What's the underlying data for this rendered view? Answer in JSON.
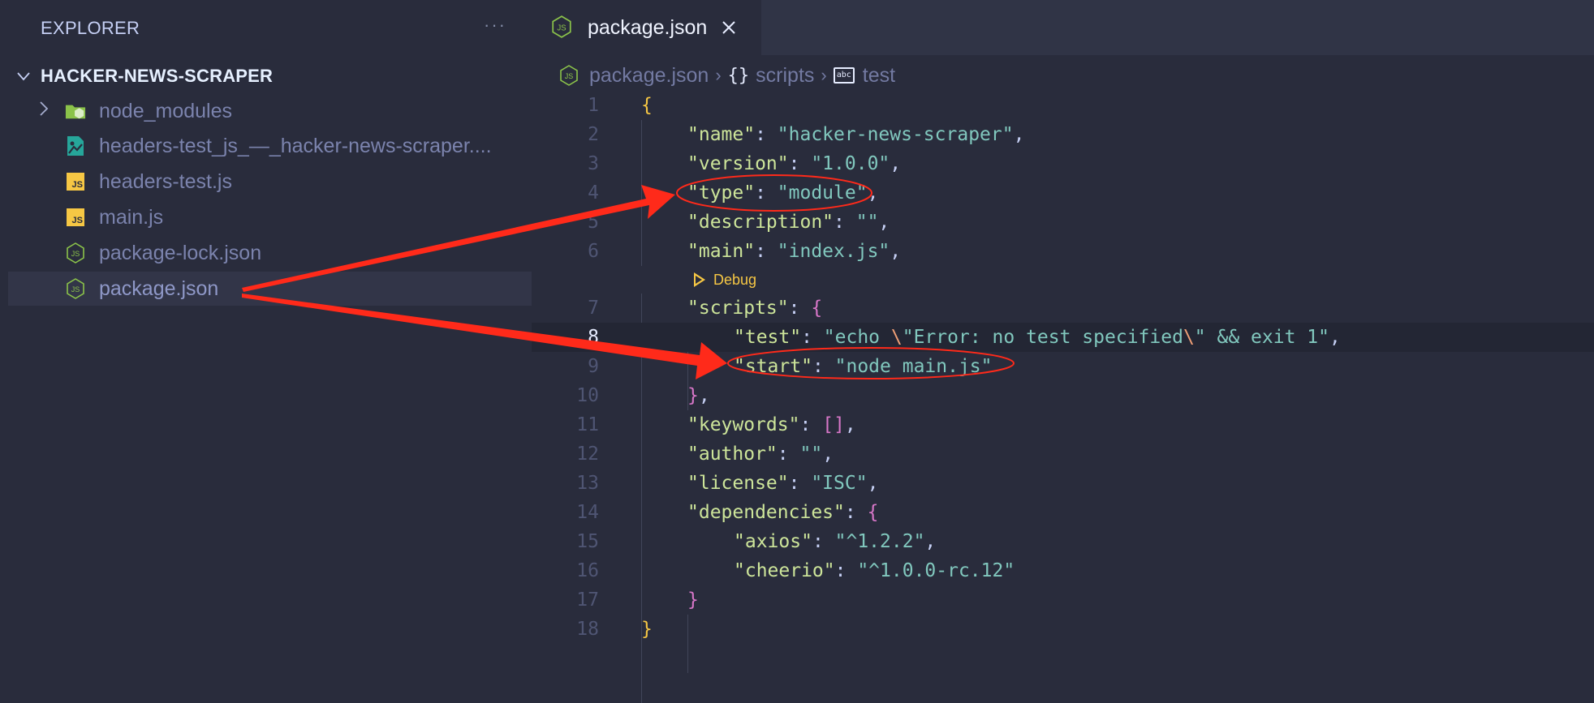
{
  "sidebar": {
    "title": "EXPLORER",
    "more_icon": "ellipsis-icon",
    "project_name": "HACKER-NEWS-SCRAPER",
    "items": [
      {
        "label": "node_modules",
        "icon": "node-folder-icon",
        "type": "folder",
        "collapsed": true
      },
      {
        "label": "headers-test_js_—_hacker-news-scraper....",
        "icon": "image-file-icon",
        "type": "file"
      },
      {
        "label": "headers-test.js",
        "icon": "javascript-file-icon",
        "type": "file"
      },
      {
        "label": "main.js",
        "icon": "javascript-file-icon",
        "type": "file"
      },
      {
        "label": "package-lock.json",
        "icon": "nodejs-icon",
        "type": "file"
      },
      {
        "label": "package.json",
        "icon": "nodejs-icon",
        "type": "file",
        "selected": true
      }
    ]
  },
  "tabs": [
    {
      "label": "package.json",
      "icon": "nodejs-icon",
      "active": true,
      "close_icon": "close-icon"
    }
  ],
  "breadcrumb": [
    {
      "label": "package.json",
      "icon": "nodejs-icon"
    },
    {
      "label": "scripts",
      "icon": "braces-icon"
    },
    {
      "label": "test",
      "icon": "string-abc-icon"
    }
  ],
  "codelens": {
    "label": "Debug",
    "icon": "play-icon"
  },
  "editor": {
    "current_line": 8,
    "lines": [
      {
        "n": "1"
      },
      {
        "n": "2"
      },
      {
        "n": "3"
      },
      {
        "n": "4"
      },
      {
        "n": "5"
      },
      {
        "n": "6"
      },
      {
        "n": "7"
      },
      {
        "n": "8"
      },
      {
        "n": "9"
      },
      {
        "n": "10"
      },
      {
        "n": "11"
      },
      {
        "n": "12"
      },
      {
        "n": "13"
      },
      {
        "n": "14"
      },
      {
        "n": "15"
      },
      {
        "n": "16"
      },
      {
        "n": "17"
      },
      {
        "n": "18"
      }
    ],
    "tokens": {
      "l1_open": "{",
      "l2_key": "\"name\"",
      "l2_val": "\"hacker-news-scraper\"",
      "l3_key": "\"version\"",
      "l3_val": "\"1.0.0\"",
      "l4_key": "\"type\"",
      "l4_val": "\"module\"",
      "l5_key": "\"description\"",
      "l5_val": "\"\"",
      "l6_key": "\"main\"",
      "l6_val": "\"index.js\"",
      "l7_key": "\"scripts\"",
      "l7_open": "{",
      "l8_key": "\"test\"",
      "l8_val_a": "\"echo ",
      "l8_esc1": "\\",
      "l8_val_b": "\"Error: no test specified",
      "l8_esc2": "\\",
      "l8_val_c": "\" && exit 1\"",
      "l9_key": "\"start\"",
      "l9_val": "\"node main.js\"",
      "l10_close": "}",
      "l11_key": "\"keywords\"",
      "l11_val": "[]",
      "l12_key": "\"author\"",
      "l12_val": "\"\"",
      "l13_key": "\"license\"",
      "l13_val": "\"ISC\"",
      "l14_key": "\"dependencies\"",
      "l14_open": "{",
      "l15_key": "\"axios\"",
      "l15_val": "\"^1.2.2\"",
      "l16_key": "\"cheerio\"",
      "l16_val": "\"^1.0.0-rc.12\"",
      "l17_close": "}",
      "l18_close": "}",
      "colon": ": ",
      "comma": ","
    }
  },
  "annotations": {
    "color": "#ff2a1a",
    "arrows": [
      {
        "from": "sidebar package.json",
        "to": "\"type\": \"module\""
      },
      {
        "from": "sidebar package.json",
        "to": "\"start\": \"node main.js\""
      }
    ]
  }
}
